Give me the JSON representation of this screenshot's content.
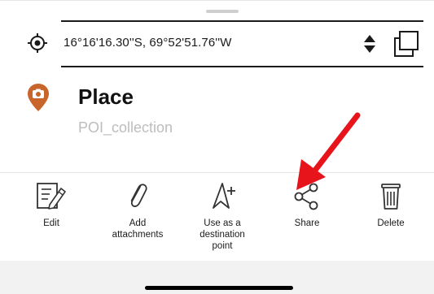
{
  "coordinates": {
    "text": "16°16'16.30''S, 69°52'51.76''W",
    "locate_icon": "crosshair-icon",
    "sort_icon": "sort-up-down-icon",
    "copy_icon": "copy-icon"
  },
  "place": {
    "title": "Place",
    "collection": "POI_collection",
    "pin_icon": "camera-pin-icon",
    "pin_color": "#c8652a"
  },
  "actions": [
    {
      "label": "Edit",
      "icon": "edit-icon"
    },
    {
      "label": "Add\nattachments",
      "icon": "paperclip-icon"
    },
    {
      "label": "Use as a\ndestination\npoint",
      "icon": "navigate-plus-icon"
    },
    {
      "label": "Share",
      "icon": "share-icon"
    },
    {
      "label": "Delete",
      "icon": "trash-icon"
    }
  ],
  "annotation": {
    "arrow_color": "#e8141c"
  }
}
